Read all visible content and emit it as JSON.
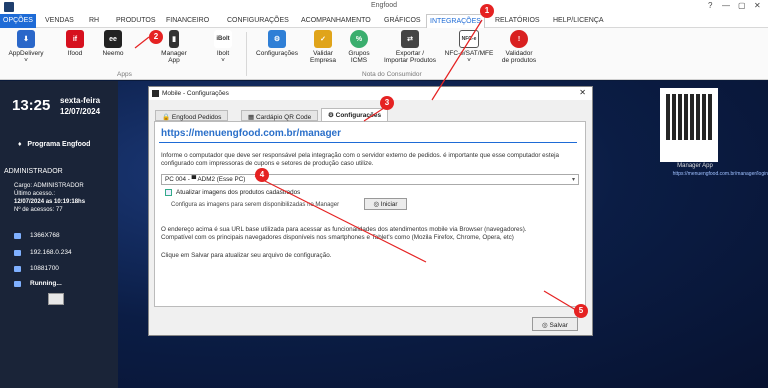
{
  "window": {
    "title": "Engfood",
    "controls": [
      "?",
      "—",
      "▢",
      "✕"
    ]
  },
  "tabs": [
    "OPÇÕES",
    "VENDAS",
    "RH",
    "PRODUTOS",
    "FINANCEIRO",
    "CONFIGURAÇÕES",
    "ACOMPANHAMENTO",
    "GRÁFICOS",
    "INTEGRAÇÕES",
    "RELATÓRIOS",
    "HELP/LICENÇA"
  ],
  "ribbon": {
    "apps_buttons": [
      {
        "label": "AppDelivery",
        "sub": "˅",
        "icon": "appdelivery-icon",
        "color": "#2a67c9"
      },
      {
        "label": "Ifood",
        "sub": "",
        "icon": "ifood-icon",
        "color": "#d6101e"
      },
      {
        "label": "Neemo",
        "sub": "",
        "icon": "neemo-icon",
        "color": "#222222"
      },
      {
        "label": "Manager",
        "sub": "App",
        "icon": "manager-app-icon",
        "color": "#333333"
      },
      {
        "label": "Ibolt",
        "sub": "˅",
        "icon": "ibolt-icon",
        "color": "#555555"
      }
    ],
    "apps_group_label": "Apps",
    "fiscal_buttons": [
      {
        "label": "Configurações",
        "sub": "",
        "icon": "gears-icon",
        "color": "#2f7fd6"
      },
      {
        "label": "Validar",
        "sub": "Empresa",
        "icon": "validar-empresa-icon",
        "color": "#e0a41a"
      },
      {
        "label": "Grupos",
        "sub": "ICMS",
        "icon": "grupos-icms-icon",
        "color": "#3aae6e"
      },
      {
        "label": "Exportar /",
        "sub": "Importar Produtos",
        "icon": "export-import-icon",
        "color": "#444444"
      },
      {
        "label": "NFC-e/SAT/MFE",
        "sub": "˅",
        "icon": "nfce-icon",
        "color": "#666666"
      },
      {
        "label": "Validador",
        "sub": "de produtos",
        "icon": "validador-icon",
        "color": "#d92020"
      }
    ],
    "fiscal_group_label": "Nota do Consumidor"
  },
  "sidebar": {
    "time": "13:25",
    "weekday": "sexta-feira",
    "date": "12/07/2024",
    "program": "Programa Engfood",
    "user": "ADMINISTRADOR",
    "info_lines": [
      "Cargo: ADMINISTRADOR",
      "Último acesso.:",
      "12/07/2024 as 10:19:18hs",
      "Nº de acessos: 77"
    ],
    "system": [
      "1366X768",
      "192.168.0.234",
      "10881700",
      "Running..."
    ]
  },
  "manager_app": {
    "label": "Manager App",
    "url": "https://menuengfood.com.br/manager/login"
  },
  "dialog": {
    "title": "Mobile - Configurações",
    "tabs": [
      "Engfood Pedidos",
      "Cardápio QR Code",
      "Configurações"
    ],
    "url": "https://menuengfood.com.br/manager",
    "intro": "Informe o computador que deve ser responsável pela integração com o servidor externo de pedidos.  é importante que esse computador esteja configurado com impressoras de cupons e setores de produção caso utilize.",
    "pc_value": "PC 004  - ▀ ADM2 (Esse PC)",
    "checkbox_label": "Atualizar imagens dos produtos cadastrados",
    "images_hint": "Configura as imagens para serem disponibilizadas no Manager",
    "iniciar": "Iniciar",
    "note1": "O endereço acima é sua URL base utilizada para acessar as funcionalidades dos atendimentos mobile via Browser (navegadores).",
    "note2": "Compatível com os principais navegadores disponíveis nos smartphones e Tablet's como (Mozila Firefox, Chrome, Opera, etc)",
    "save_hint": "Clique em  Salvar  para atualizar seu arquivo de configuração.",
    "save": "Salvar"
  },
  "markers": [
    "1",
    "2",
    "3",
    "4",
    "5"
  ]
}
